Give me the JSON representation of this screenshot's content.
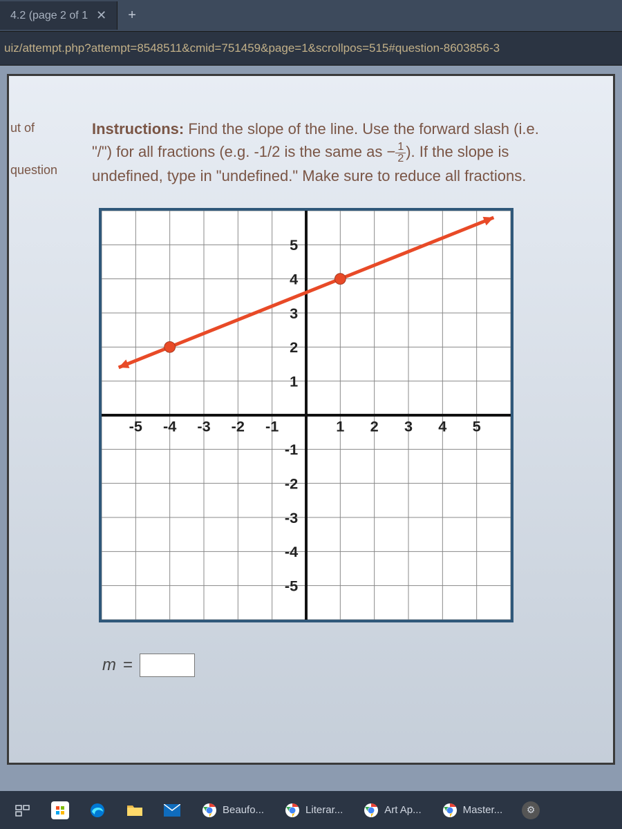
{
  "browser": {
    "tab_title": "4.2 (page 2 of 1",
    "url": "uiz/attempt.php?attempt=8548511&cmid=751459&page=1&scrollpos=515#question-8603856-3"
  },
  "side": {
    "out_of": "ut of",
    "question": "question"
  },
  "instructions": {
    "label": "Instructions:",
    "text1": " Find the slope of the line. Use the forward slash (i.e. \"/\") for all fractions (e.g. -1/2 is the same as ",
    "frac_num": "1",
    "frac_den": "2",
    "text2": "). If the slope is undefined, type in \"undefined.\" Make sure to reduce all fractions."
  },
  "answer": {
    "variable": "m",
    "equals": "=",
    "value": ""
  },
  "taskbar": {
    "items": [
      "Beaufo...",
      "Literar...",
      "Art Ap...",
      "Master..."
    ]
  },
  "chart_data": {
    "type": "line",
    "title": "",
    "xlabel": "",
    "ylabel": "",
    "xlim": [
      -6,
      6
    ],
    "ylim": [
      -6,
      6
    ],
    "x_ticks": [
      -5,
      -4,
      -3,
      -2,
      -1,
      1,
      2,
      3,
      4,
      5
    ],
    "y_ticks": [
      5,
      4,
      3,
      2,
      1,
      -1,
      -2,
      -3,
      -4,
      -5
    ],
    "series": [
      {
        "name": "line",
        "points": [
          [
            -4,
            2
          ],
          [
            1,
            4
          ]
        ],
        "extend": true
      }
    ]
  }
}
